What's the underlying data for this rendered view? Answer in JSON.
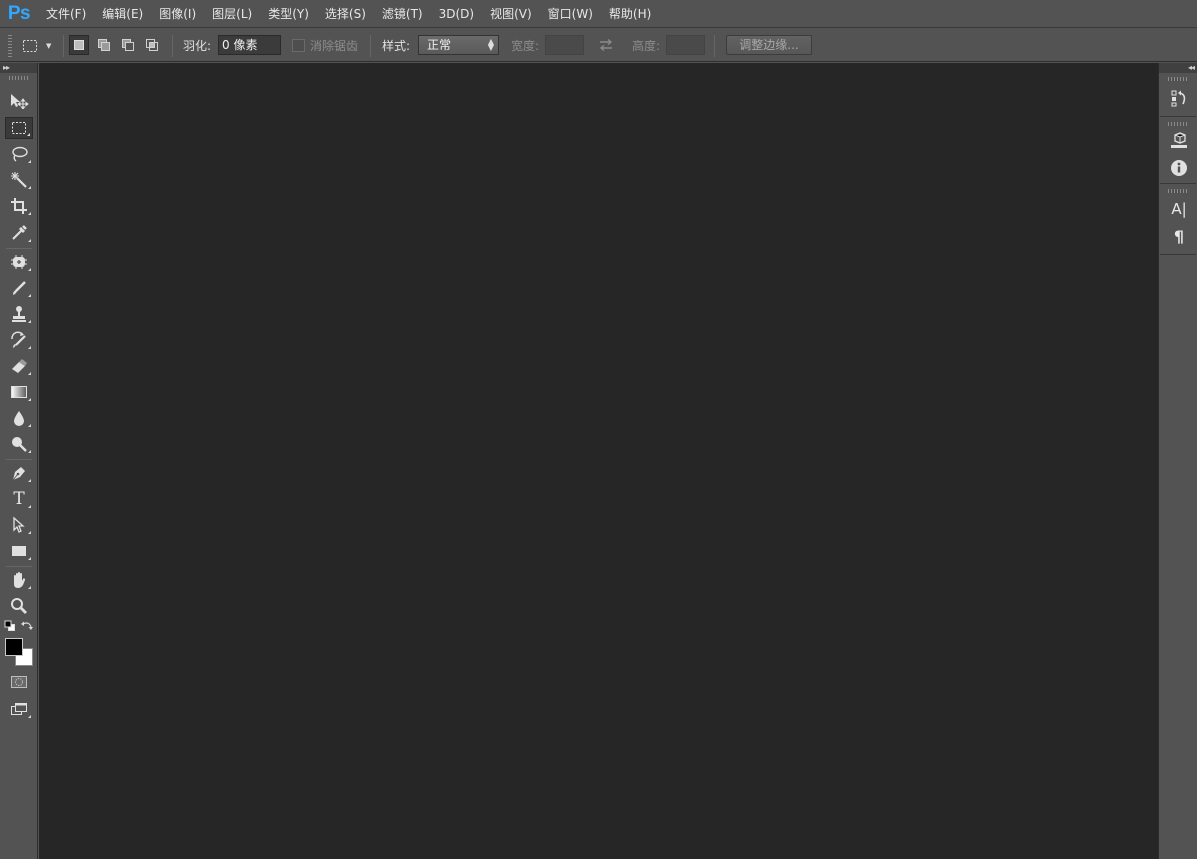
{
  "app": {
    "logo": "Ps",
    "accent_color": "#31a8ff",
    "canvas_color": "#262626",
    "chrome_color": "#535353"
  },
  "menu": [
    {
      "id": "file",
      "label": "文件(F)"
    },
    {
      "id": "edit",
      "label": "编辑(E)"
    },
    {
      "id": "image",
      "label": "图像(I)"
    },
    {
      "id": "layer",
      "label": "图层(L)"
    },
    {
      "id": "type",
      "label": "类型(Y)"
    },
    {
      "id": "select",
      "label": "选择(S)"
    },
    {
      "id": "filter",
      "label": "滤镜(T)"
    },
    {
      "id": "3d",
      "label": "3D(D)"
    },
    {
      "id": "view",
      "label": "视图(V)"
    },
    {
      "id": "window",
      "label": "窗口(W)"
    },
    {
      "id": "help",
      "label": "帮助(H)"
    }
  ],
  "options": {
    "feather_label": "羽化:",
    "feather_value": "0 像素",
    "antialias_label": "消除锯齿",
    "antialias_checked": false,
    "style_label": "样式:",
    "style_value": "正常",
    "width_label": "宽度:",
    "width_value": "",
    "height_label": "高度:",
    "height_value": "",
    "refine_edge_label": "调整边缘...",
    "selection_modes": [
      "new-selection",
      "add-to-selection",
      "subtract-from-selection",
      "intersect-with-selection"
    ],
    "active_mode": "new-selection"
  },
  "tools": [
    {
      "id": "move",
      "icon": "move-icon",
      "active": false
    },
    {
      "id": "rect-marquee",
      "icon": "rectangular-marquee-icon",
      "active": true
    },
    {
      "id": "lasso",
      "icon": "lasso-icon",
      "active": false
    },
    {
      "id": "magic-wand",
      "icon": "magic-wand-icon",
      "active": false
    },
    {
      "id": "crop",
      "icon": "crop-icon",
      "active": false
    },
    {
      "id": "eyedropper",
      "icon": "eyedropper-icon",
      "active": false
    },
    {
      "id": "healing",
      "icon": "spot-healing-icon",
      "active": false
    },
    {
      "id": "brush",
      "icon": "brush-icon",
      "active": false
    },
    {
      "id": "stamp",
      "icon": "clone-stamp-icon",
      "active": false
    },
    {
      "id": "history-brush",
      "icon": "history-brush-icon",
      "active": false
    },
    {
      "id": "eraser",
      "icon": "eraser-icon",
      "active": false
    },
    {
      "id": "gradient",
      "icon": "gradient-icon",
      "active": false
    },
    {
      "id": "blur",
      "icon": "blur-icon",
      "active": false
    },
    {
      "id": "dodge",
      "icon": "dodge-icon",
      "active": false
    },
    {
      "id": "pen",
      "icon": "pen-icon",
      "active": false
    },
    {
      "id": "type",
      "icon": "type-icon",
      "label": "T",
      "active": false
    },
    {
      "id": "path-select",
      "icon": "path-selection-icon",
      "active": false
    },
    {
      "id": "shape",
      "icon": "rectangle-shape-icon",
      "active": false
    },
    {
      "id": "hand",
      "icon": "hand-icon",
      "active": false
    },
    {
      "id": "zoom",
      "icon": "zoom-icon",
      "active": false
    }
  ],
  "colors": {
    "foreground": "#000000",
    "background": "#ffffff"
  },
  "dock": [
    {
      "id": "history",
      "icon": "history-icon"
    },
    {
      "id": "3d",
      "icon": "3d-panel-icon"
    },
    {
      "id": "info",
      "icon": "info-icon"
    },
    {
      "id": "character",
      "icon": "character-icon",
      "label": "A|"
    },
    {
      "id": "paragraph",
      "icon": "paragraph-icon",
      "label": "¶"
    }
  ]
}
